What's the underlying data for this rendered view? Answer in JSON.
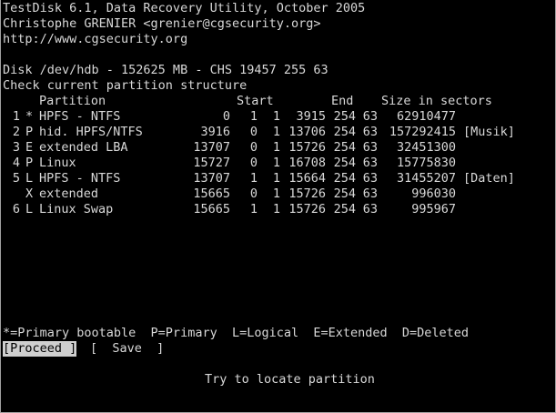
{
  "header": {
    "line1": "TestDisk 6.1, Data Recovery Utility, October 2005",
    "line2": "Christophe GRENIER <grenier@cgsecurity.org>",
    "line3": "http://www.cgsecurity.org"
  },
  "disk_info": "Disk /dev/hdb - 152625 MB - CHS 19457 255 63",
  "status": "Check current partition structure",
  "table": {
    "headers": {
      "partition": "Partition",
      "start": "Start",
      "end": "End",
      "size": "Size in sectors"
    },
    "rows": [
      {
        "num": "1",
        "flag": "*",
        "type": "HPFS - NTFS",
        "sc": "0",
        "sh": "1",
        "ss": "1",
        "ec": "3915",
        "eh": "254",
        "es": "63",
        "size": "62910477",
        "label": ""
      },
      {
        "num": "2",
        "flag": "P",
        "type": "hid. HPFS/NTFS",
        "sc": "3916",
        "sh": "0",
        "ss": "1",
        "ec": "13706",
        "eh": "254",
        "es": "63",
        "size": "157292415",
        "label": "[Musik]"
      },
      {
        "num": "3",
        "flag": "E",
        "type": "extended LBA",
        "sc": "13707",
        "sh": "0",
        "ss": "1",
        "ec": "15726",
        "eh": "254",
        "es": "63",
        "size": "32451300",
        "label": ""
      },
      {
        "num": "4",
        "flag": "P",
        "type": "Linux",
        "sc": "15727",
        "sh": "0",
        "ss": "1",
        "ec": "16708",
        "eh": "254",
        "es": "63",
        "size": "15775830",
        "label": ""
      },
      {
        "num": "5",
        "flag": "L",
        "type": "HPFS - NTFS",
        "sc": "13707",
        "sh": "1",
        "ss": "1",
        "ec": "15664",
        "eh": "254",
        "es": "63",
        "size": "31455207",
        "label": "[Daten]"
      },
      {
        "num": "",
        "flag": "X",
        "type": "extended",
        "sc": "15665",
        "sh": "0",
        "ss": "1",
        "ec": "15726",
        "eh": "254",
        "es": "63",
        "size": "996030",
        "label": ""
      },
      {
        "num": "6",
        "flag": "L",
        "type": "Linux Swap",
        "sc": "15665",
        "sh": "1",
        "ss": "1",
        "ec": "15726",
        "eh": "254",
        "es": "63",
        "size": "995967",
        "label": ""
      }
    ]
  },
  "legend": "*=Primary bootable  P=Primary  L=Logical  E=Extended  D=Deleted",
  "menu": {
    "proceed": "[Proceed ]",
    "save": "[  Save  ]",
    "selected": "proceed"
  },
  "hint": "Try to locate partition",
  "colors": {
    "background": "#000000",
    "text": "#d8d8d8",
    "selected_bg": "#cfcfcf",
    "selected_fg": "#000000"
  }
}
